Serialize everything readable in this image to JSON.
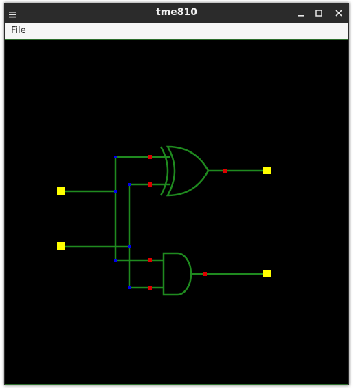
{
  "window": {
    "title": "tme810",
    "menu_icon": "hamburger-icon",
    "controls": [
      "minimize-icon",
      "maximize-icon",
      "close-icon"
    ]
  },
  "menubar": {
    "items": [
      {
        "label": "File",
        "mnemonic": "F"
      }
    ]
  },
  "circuit": {
    "colors": {
      "background": "#000000",
      "wire": "#1f8a1f",
      "gate": "#1f8a1f",
      "io_terminal": "#ffff00",
      "gate_pin": "#dd0000",
      "junction": "#0000ee"
    },
    "inputs": 2,
    "outputs": 2,
    "gates": [
      "XOR",
      "AND"
    ]
  }
}
